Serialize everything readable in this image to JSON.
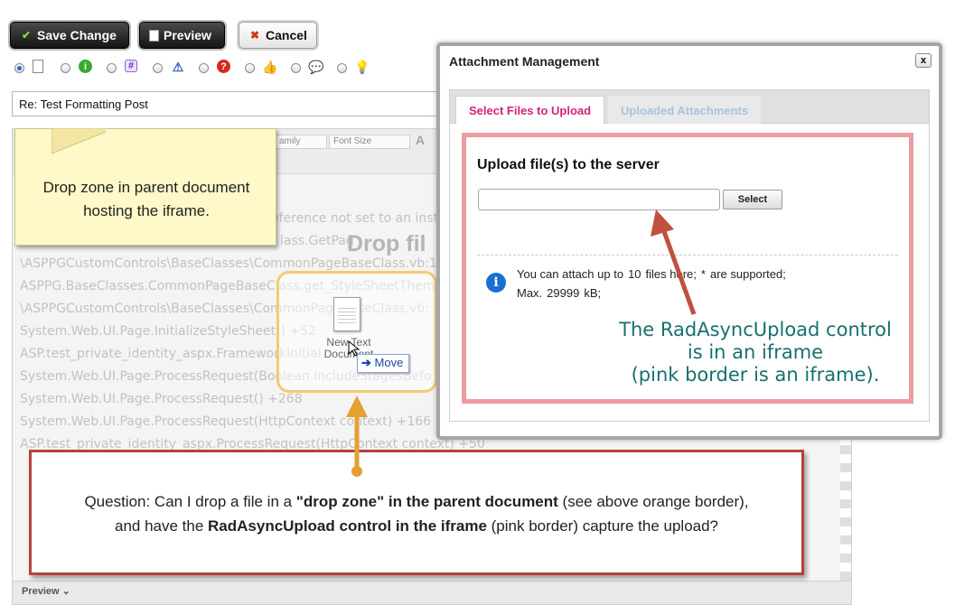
{
  "toolbar": {
    "save_label": "Save Change",
    "preview_label": "Preview",
    "cancel_label": "Cancel"
  },
  "message_icons": [
    "document-icon",
    "info-icon",
    "hash-icon",
    "warning-icon",
    "question-icon",
    "thumbs-up-icon",
    "speech-bubble-icon",
    "lightbulb-icon"
  ],
  "message_icon_selected": 0,
  "subject": {
    "value": "Re: Test Formatting Post"
  },
  "editor": {
    "font_family_label": "amily",
    "font_size_label": "Font Size",
    "drop_word": "Drop fil",
    "code_lines": [
      "eference not set to an inst",
      "lass.GetPag",
      "\\ASPPGCustomControls\\BaseClasses\\CommonPageBaseClass.vb:1",
      "ASPPG.BaseClasses.CommonPageBaseClass.get_StyleSheetThem",
      "\\ASPPGCustomControls\\BaseClasses\\CommonPageBaseClass.vb:",
      "System.Web.UI.Page.InitializeStyleSheet() +52",
      "ASP.test_private_identity_aspx.FrameworkInitial",
      "System.Web.UI.Page.ProcessRequest(Boolean includeStagesBefo",
      "System.Web.UI.Page.ProcessRequest() +268",
      "System.Web.UI.Page.ProcessRequest(HttpContext context) +166",
      "ASP.test_private_identity_aspx.ProcessRequest(HttpContext context) +50"
    ],
    "bottom_tab": "Preview"
  },
  "note": {
    "line1": "Drop zone in parent document",
    "line2": "hosting the iframe."
  },
  "drag": {
    "file_label": "New Text Document",
    "move_label": "Move"
  },
  "dialog": {
    "title": "Attachment Management",
    "close": "x",
    "tabs": [
      {
        "label": "Select Files to Upload",
        "active": true
      },
      {
        "label": "Uploaded Attachments",
        "active": false
      }
    ],
    "upload_title": "Upload file(s) to the server",
    "select_label": "Select",
    "info_prefix": "You can attach up to",
    "max_files": "10",
    "info_middle": "files here;",
    "file_types": "*",
    "info_suffix": "are supported;",
    "max_label": "Max.",
    "max_size": "29999",
    "size_unit": "kB;"
  },
  "annotations": {
    "iframe_line1": "The RadAsyncUpload control",
    "iframe_line2": "is in an iframe",
    "iframe_line3": "(pink border is an iframe).",
    "question_p1": "Question: Can I drop a file in a ",
    "question_b1": "\"drop zone\" in the parent document",
    "question_p2": " (see above orange border),",
    "question_p3": "and have the ",
    "question_b2": "RadAsyncUpload control in the iframe",
    "question_p4": " (pink border) capture the upload?"
  },
  "colors": {
    "iframe_border": "#eb9ca1",
    "dropzone_border": "#f3cb72",
    "question_border": "#b8403a",
    "active_tab_text": "#d4237a",
    "teal_text": "#17706e",
    "arrow_red": "#c0503f",
    "arrow_orange": "#e6a030"
  }
}
